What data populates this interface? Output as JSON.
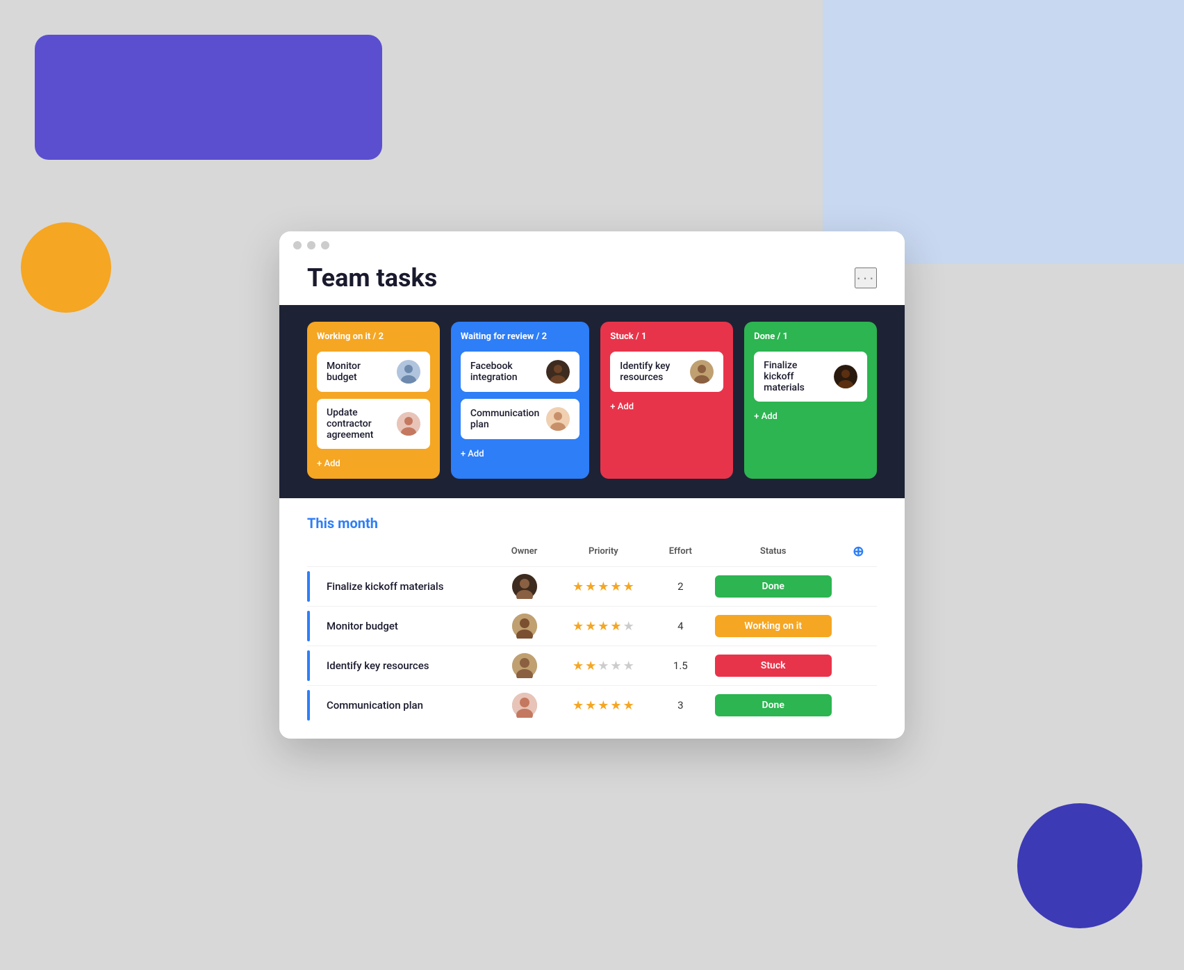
{
  "bg": {
    "shapes": [
      "blue-rect",
      "purple-rect",
      "yellow-circle",
      "purple-circle"
    ]
  },
  "window": {
    "title": "Team tasks",
    "more_label": "···"
  },
  "board": {
    "columns": [
      {
        "id": "working",
        "label": "Working on it / 2",
        "color": "orange",
        "cards": [
          {
            "title": "Monitor budget",
            "avatar": "👤"
          },
          {
            "title": "Update contractor agreement",
            "avatar": "👩"
          }
        ],
        "add_label": "+ Add"
      },
      {
        "id": "waiting",
        "label": "Waiting for review / 2",
        "color": "blue",
        "cards": [
          {
            "title": "Facebook integration",
            "avatar": "👩‍🦱"
          },
          {
            "title": "Communication plan",
            "avatar": "👩‍🦰"
          }
        ],
        "add_label": "+ Add"
      },
      {
        "id": "stuck",
        "label": "Stuck / 1",
        "color": "red",
        "cards": [
          {
            "title": "Identify key resources",
            "avatar": "👨"
          }
        ],
        "add_label": "+ Add"
      },
      {
        "id": "done",
        "label": "Done / 1",
        "color": "green",
        "cards": [
          {
            "title": "Finalize kickoff materials",
            "avatar": "👨‍🦱"
          }
        ],
        "add_label": "+ Add"
      }
    ]
  },
  "table": {
    "section_title": "This month",
    "columns": [
      "Owner",
      "Priority",
      "Effort",
      "Status"
    ],
    "rows": [
      {
        "task": "Finalize kickoff materials",
        "owner_avatar": "👩‍🦱",
        "stars_filled": 5,
        "stars_total": 5,
        "effort": "2",
        "status": "Done",
        "status_class": "done"
      },
      {
        "task": "Monitor budget",
        "owner_avatar": "👨‍🦳",
        "stars_filled": 4,
        "stars_total": 5,
        "effort": "4",
        "status": "Working on it",
        "status_class": "working"
      },
      {
        "task": "Identify key resources",
        "owner_avatar": "👨",
        "stars_filled": 2,
        "stars_total": 5,
        "effort": "1.5",
        "status": "Stuck",
        "status_class": "stuck"
      },
      {
        "task": "Communication plan",
        "owner_avatar": "👩",
        "stars_filled": 5,
        "stars_total": 5,
        "effort": "3",
        "status": "Done",
        "status_class": "done"
      }
    ]
  }
}
